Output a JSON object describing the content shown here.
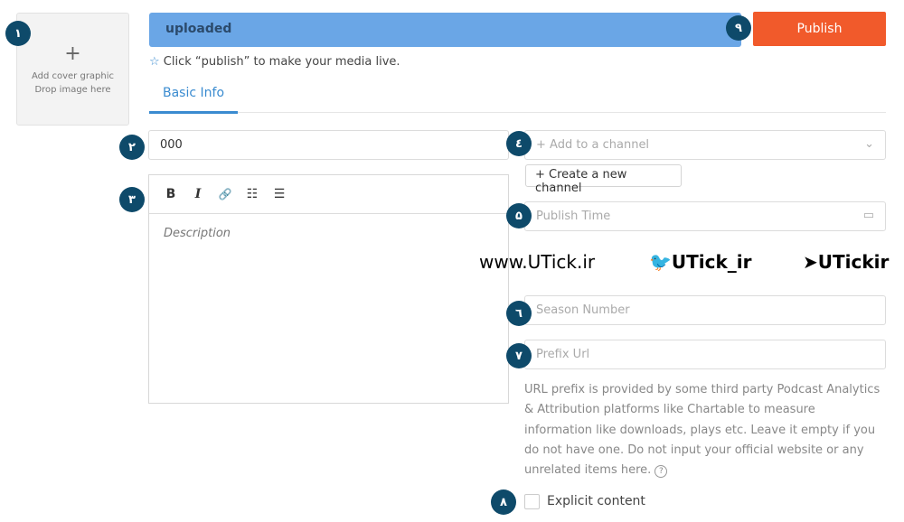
{
  "cover": {
    "line1": "Add cover graphic",
    "line2": "Drop image here",
    "plus": "+"
  },
  "status": "uploaded",
  "publish_label": "Publish",
  "hint": "Click “publish” to make your media live.",
  "tab": "Basic Info",
  "title_value": "000",
  "channel_placeholder": "+ Add to a channel",
  "create_channel": "Create a new channel",
  "publish_time_placeholder": "Publish Time",
  "description_placeholder": "Description",
  "season_placeholder": "Season Number",
  "prefix_placeholder": "Prefix Url",
  "prefix_help": "URL prefix is provided by some third party Podcast Analytics & Attribution platforms like Chartable to measure information like downloads, plays etc. Leave it empty if you do not have one. Do not input your official website or any unrelated items here.",
  "explicit_label": "Explicit content",
  "toolbar": {
    "bold": "B",
    "italic": "I",
    "link": "🔗",
    "ol": "☷",
    "ul": "☰"
  },
  "badges": [
    "۱",
    "۲",
    "۳",
    "٤",
    "۵",
    "٦",
    "۷",
    "۸",
    "۹"
  ],
  "watermark": {
    "site": "www.UTick.ir",
    "twitter": "UTick_ir",
    "telegram": "UTickir"
  },
  "colors": {
    "accent": "#3a8bd0",
    "publish": "#f15a2b",
    "status_bar": "#6aa6e6",
    "badge": "#0e4a6a"
  }
}
